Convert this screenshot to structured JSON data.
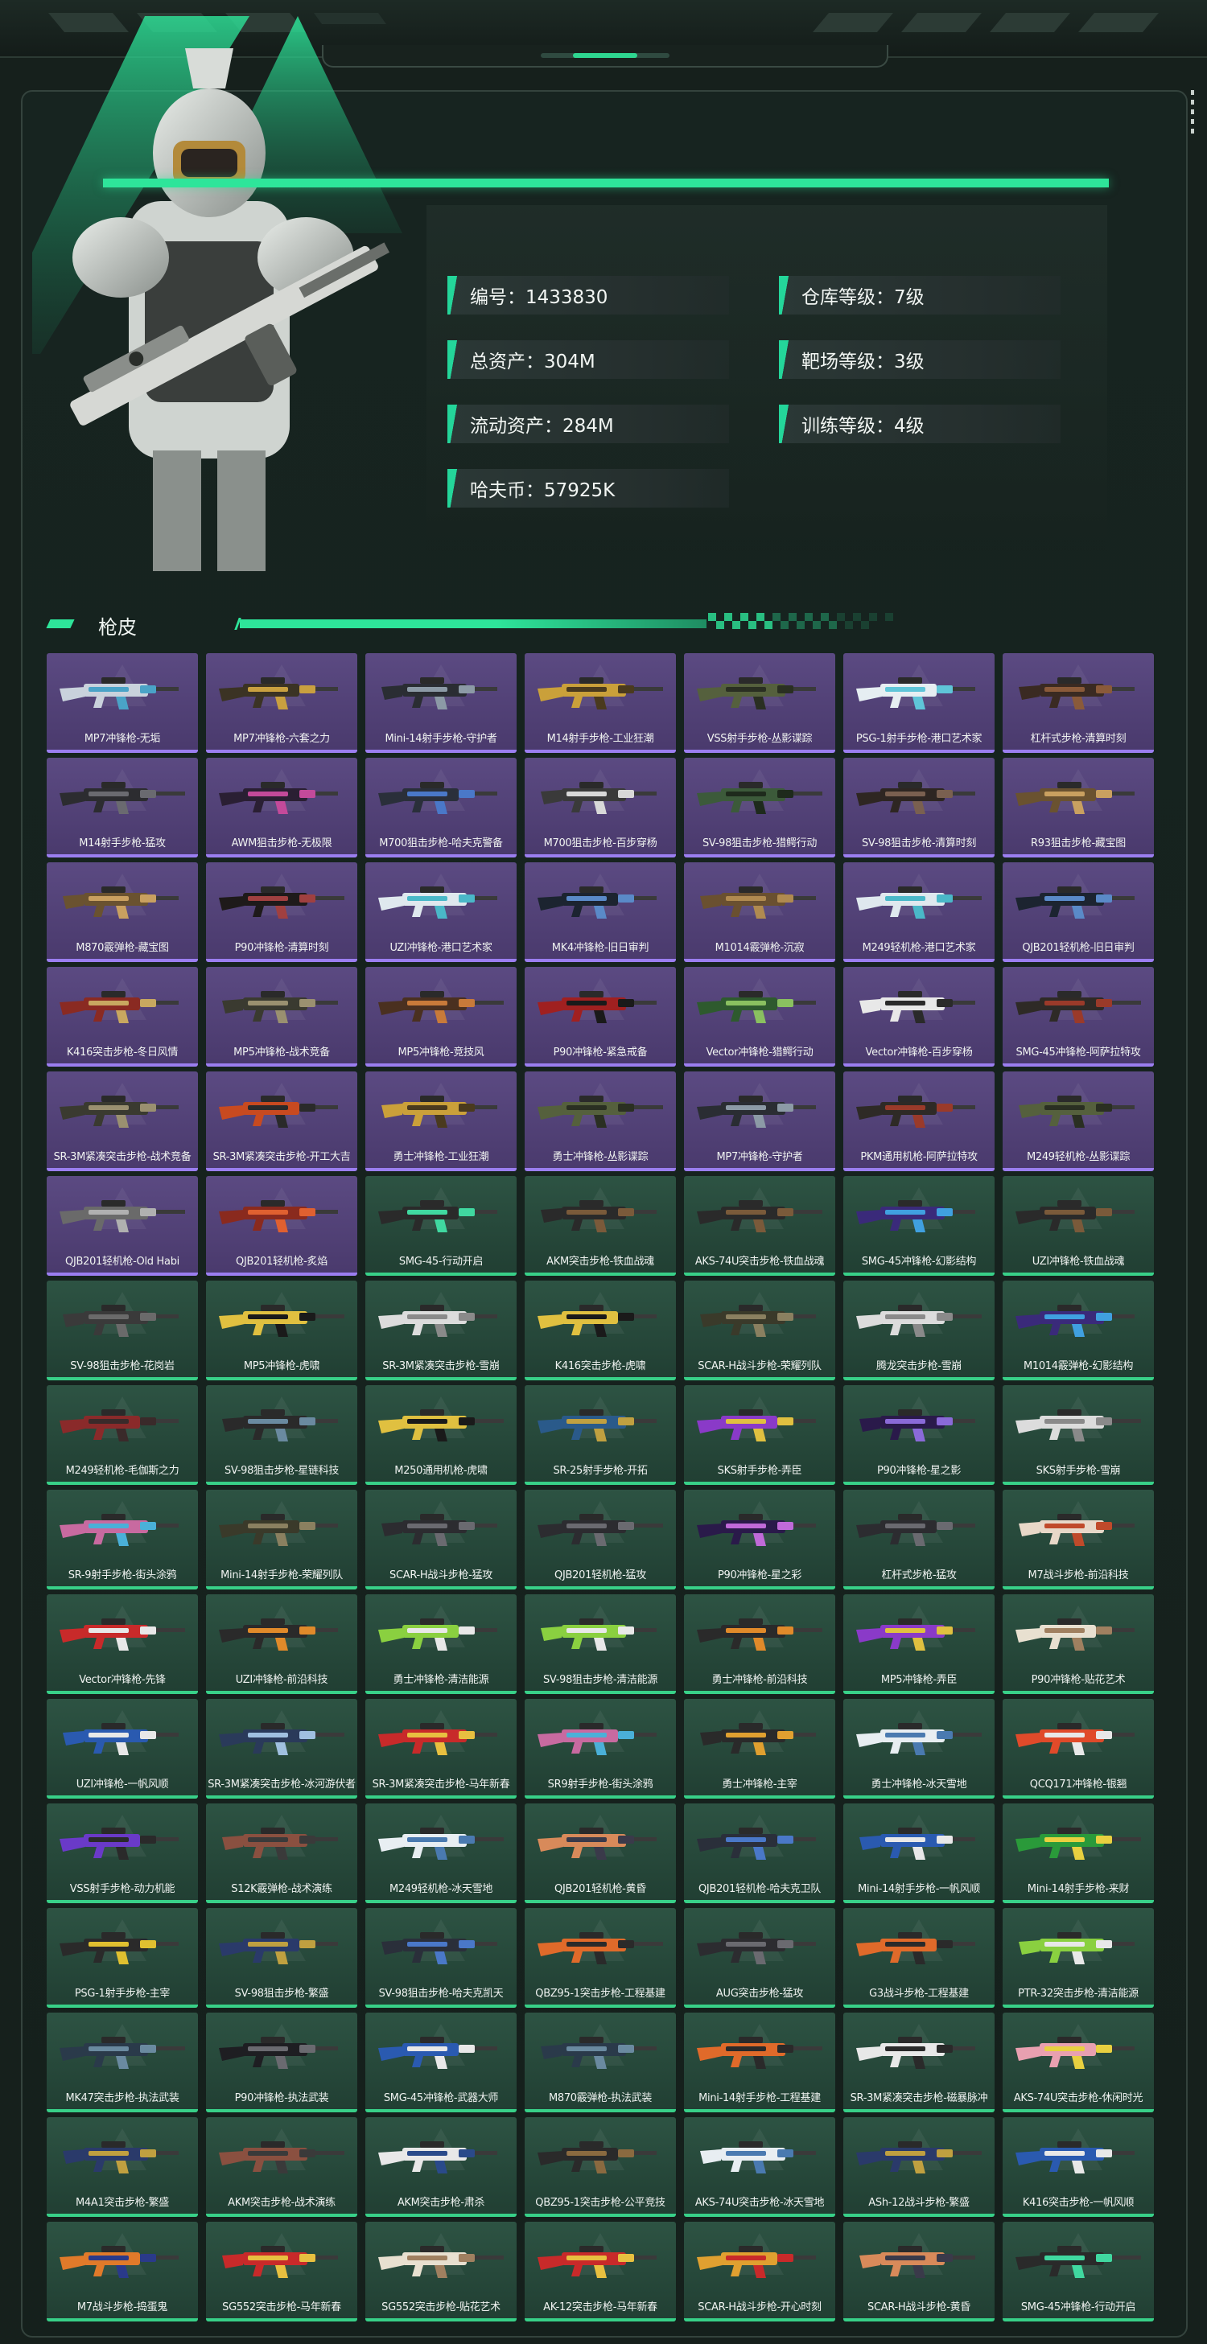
{
  "profile": {
    "stats": [
      {
        "label": "编号：1433830"
      },
      {
        "label": "仓库等级：7级"
      },
      {
        "label": "总资产：304M"
      },
      {
        "label": "靶场等级：3级"
      },
      {
        "label": "流动资产：284M"
      },
      {
        "label": "训练等级：4级"
      },
      {
        "label": "哈夫币：57925K"
      }
    ]
  },
  "section": {
    "title": "枪皮"
  },
  "colors": {
    "accent": "#2ee59a",
    "purple_card": "#4f3f74",
    "green_card": "#264a3b"
  },
  "skins": [
    {
      "name": "MP7冲锋枪-无垢",
      "rarity": "purple",
      "c1": "#c9d2dc",
      "c2": "#4aa3c7"
    },
    {
      "name": "MP7冲锋枪-六套之力",
      "rarity": "purple",
      "c1": "#3b3324",
      "c2": "#c9a040"
    },
    {
      "name": "Mini-14射手步枪-守护者",
      "rarity": "purple",
      "c1": "#2a2d33",
      "c2": "#8c9aa6"
    },
    {
      "name": "M14射手步枪-工业狂潮",
      "rarity": "purple",
      "c1": "#caa03a",
      "c2": "#4a3a1e"
    },
    {
      "name": "VSS射手步枪-丛影谍踪",
      "rarity": "purple",
      "c1": "#55603d",
      "c2": "#2a2f22"
    },
    {
      "name": "PSG-1射手步枪-港口艺术家",
      "rarity": "purple",
      "c1": "#e6eef2",
      "c2": "#5fc5d8"
    },
    {
      "name": "杠杆式步枪-清算时刻",
      "rarity": "purple",
      "c1": "#3a2a22",
      "c2": "#8a5a3a"
    },
    {
      "name": "M14射手步枪-猛攻",
      "rarity": "purple",
      "c1": "#2c2c30",
      "c2": "#6a6a70"
    },
    {
      "name": "AWM狙击步枪-无极限",
      "rarity": "purple",
      "c1": "#2a1f33",
      "c2": "#c34a9a"
    },
    {
      "name": "M700狙击步枪-哈夫克警备",
      "rarity": "purple",
      "c1": "#2a2f3a",
      "c2": "#4a78c8"
    },
    {
      "name": "M700狙击步枪-百步穿杨",
      "rarity": "purple",
      "c1": "#3a3a3a",
      "c2": "#d8d8d8"
    },
    {
      "name": "SV-98狙击步枪-猎鳄行动",
      "rarity": "purple",
      "c1": "#3c5a3a",
      "c2": "#1e2a1c"
    },
    {
      "name": "SV-98狙击步枪-清算时刻",
      "rarity": "purple",
      "c1": "#2e2622",
      "c2": "#7a6050"
    },
    {
      "name": "R93狙击步枪-藏宝图",
      "rarity": "purple",
      "c1": "#6a5230",
      "c2": "#c9a060"
    },
    {
      "name": "M870霰弹枪-藏宝图",
      "rarity": "purple",
      "c1": "#6a5230",
      "c2": "#c9a060"
    },
    {
      "name": "P90冲锋枪-清算时刻",
      "rarity": "purple",
      "c1": "#1e1a1a",
      "c2": "#a04040"
    },
    {
      "name": "UZI冲锋枪-港口艺术家",
      "rarity": "purple",
      "c1": "#dfe8ee",
      "c2": "#4ab8c8"
    },
    {
      "name": "MK4冲锋枪-旧日审判",
      "rarity": "purple",
      "c1": "#1c2430",
      "c2": "#5a8ac8"
    },
    {
      "name": "M1014霰弹枪-沉寂",
      "rarity": "purple",
      "c1": "#6a5030",
      "c2": "#b08a50"
    },
    {
      "name": "M249轻机枪-港口艺术家",
      "rarity": "purple",
      "c1": "#dfe8ee",
      "c2": "#4ab8c8"
    },
    {
      "name": "QJB201轻机枪-旧日审判",
      "rarity": "purple",
      "c1": "#1c2430",
      "c2": "#5a8ac8"
    },
    {
      "name": "K416突击步枪-冬日风情",
      "rarity": "purple",
      "c1": "#8a2a22",
      "c2": "#c8a860"
    },
    {
      "name": "MP5冲锋枪-战术竞备",
      "rarity": "purple",
      "c1": "#3a3a30",
      "c2": "#9a9070"
    },
    {
      "name": "MP5冲锋枪-竞技风",
      "rarity": "purple",
      "c1": "#4a3020",
      "c2": "#c87a3a"
    },
    {
      "name": "P90冲锋枪-紧急戒备",
      "rarity": "purple",
      "c1": "#a02020",
      "c2": "#1a1a1a"
    },
    {
      "name": "Vector冲锋枪-猎鳄行动",
      "rarity": "purple",
      "c1": "#2e5a2e",
      "c2": "#8ac060"
    },
    {
      "name": "Vector冲锋枪-百步穿杨",
      "rarity": "purple",
      "c1": "#e8e8e8",
      "c2": "#2a2a2a"
    },
    {
      "name": "SMG-45冲锋枪-阿萨拉特攻",
      "rarity": "purple",
      "c1": "#2e2a26",
      "c2": "#9a3a2a"
    },
    {
      "name": "SR-3M紧凑突击步枪-战术竞备",
      "rarity": "purple",
      "c1": "#3a3a30",
      "c2": "#9a9070"
    },
    {
      "name": "SR-3M紧凑突击步枪-开工大吉",
      "rarity": "purple",
      "c1": "#c84a20",
      "c2": "#2a2a2a"
    },
    {
      "name": "勇士冲锋枪-工业狂潮",
      "rarity": "purple",
      "c1": "#caa03a",
      "c2": "#4a3a1e"
    },
    {
      "name": "勇士冲锋枪-丛影谍踪",
      "rarity": "purple",
      "c1": "#55603d",
      "c2": "#2a2f22"
    },
    {
      "name": "MP7冲锋枪-守护者",
      "rarity": "purple",
      "c1": "#2a2d33",
      "c2": "#8c9aa6"
    },
    {
      "name": "PKM通用机枪-阿萨拉特攻",
      "rarity": "purple",
      "c1": "#2e2a26",
      "c2": "#9a3a2a"
    },
    {
      "name": "M249轻机枪-丛影谍踪",
      "rarity": "purple",
      "c1": "#55603d",
      "c2": "#2a2f22"
    },
    {
      "name": "QJB201轻机枪-Old Habi",
      "rarity": "purple",
      "c1": "#6a6a6a",
      "c2": "#b0b0b0"
    },
    {
      "name": "QJB201轻机枪-炙焰",
      "rarity": "purple",
      "c1": "#8a2a1e",
      "c2": "#e06030"
    },
    {
      "name": "SMG-45-行动开启",
      "rarity": "green",
      "c1": "#2a2a2a",
      "c2": "#40d8a0"
    },
    {
      "name": "AKM突击步枪-铁血战魂",
      "rarity": "green",
      "c1": "#2a2a2a",
      "c2": "#7a5a3a"
    },
    {
      "name": "AKS-74U突击步枪-铁血战魂",
      "rarity": "green",
      "c1": "#2a2a2a",
      "c2": "#7a5a3a"
    },
    {
      "name": "SMG-45冲锋枪-幻影结构",
      "rarity": "green",
      "c1": "#3a2a7a",
      "c2": "#40a0e0"
    },
    {
      "name": "UZI冲锋枪-铁血战魂",
      "rarity": "green",
      "c1": "#2a2a2a",
      "c2": "#7a5a3a"
    },
    {
      "name": "SV-98狙击步枪-花岗岩",
      "rarity": "green",
      "c1": "#3a3a3a",
      "c2": "#6a6a6a"
    },
    {
      "name": "MP5冲锋枪-虎啸",
      "rarity": "green",
      "c1": "#e0c040",
      "c2": "#1a1a1a"
    },
    {
      "name": "SR-3M紧凑突击步枪-雪崩",
      "rarity": "green",
      "c1": "#dcdcdc",
      "c2": "#8a8a8a"
    },
    {
      "name": "K416突击步枪-虎啸",
      "rarity": "green",
      "c1": "#e0c040",
      "c2": "#1a1a1a"
    },
    {
      "name": "SCAR-H战斗步枪-荣耀列队",
      "rarity": "green",
      "c1": "#3a3a2a",
      "c2": "#8a8060"
    },
    {
      "name": "腾龙突击步枪-雪崩",
      "rarity": "green",
      "c1": "#dcdcdc",
      "c2": "#8a8a8a"
    },
    {
      "name": "M1014霰弹枪-幻影结构",
      "rarity": "green",
      "c1": "#3a2a7a",
      "c2": "#40a0e0"
    },
    {
      "name": "M249轻机枪-毛伽斯之力",
      "rarity": "green",
      "c1": "#8a2a2a",
      "c2": "#3a2a2a"
    },
    {
      "name": "SV-98狙击步枪-星链科技",
      "rarity": "green",
      "c1": "#2a2a2a",
      "c2": "#6a8aa0"
    },
    {
      "name": "M250通用机枪-虎啸",
      "rarity": "green",
      "c1": "#e0c040",
      "c2": "#1a1a1a"
    },
    {
      "name": "SR-25射手步枪-开拓",
      "rarity": "green",
      "c1": "#2a5a8a",
      "c2": "#c0a040"
    },
    {
      "name": "SKS射手步枪-弄臣",
      "rarity": "green",
      "c1": "#8a3ac8",
      "c2": "#e0c040"
    },
    {
      "name": "P90冲锋枪-星之影",
      "rarity": "green",
      "c1": "#2a1a4a",
      "c2": "#8a6ad8"
    },
    {
      "name": "SKS射手步枪-雪崩",
      "rarity": "green",
      "c1": "#dcdcdc",
      "c2": "#8a8a8a"
    },
    {
      "name": "SR-9射手步枪-街头涂鸦",
      "rarity": "green",
      "c1": "#c86aa0",
      "c2": "#4ab0d8"
    },
    {
      "name": "Mini-14射手步枪-荣耀列队",
      "rarity": "green",
      "c1": "#3a3a2a",
      "c2": "#8a8060"
    },
    {
      "name": "SCAR-H战斗步枪-猛攻",
      "rarity": "green",
      "c1": "#2c2c30",
      "c2": "#6a6a70"
    },
    {
      "name": "QJB201轻机枪-猛攻",
      "rarity": "green",
      "c1": "#2c2c30",
      "c2": "#6a6a70"
    },
    {
      "name": "P90冲锋枪-星之彩",
      "rarity": "green",
      "c1": "#2a1a4a",
      "c2": "#c06ad8"
    },
    {
      "name": "杠杆式步枪-猛攻",
      "rarity": "green",
      "c1": "#2c2c30",
      "c2": "#6a6a70"
    },
    {
      "name": "M7战斗步枪-前沿科技",
      "rarity": "green",
      "c1": "#e8d8c8",
      "c2": "#c04a2a"
    },
    {
      "name": "Vector冲锋枪-先锋",
      "rarity": "green",
      "c1": "#c82a2a",
      "c2": "#e8e8e8"
    },
    {
      "name": "UZI冲锋枪-前沿科技",
      "rarity": "green",
      "c1": "#2a2a2a",
      "c2": "#e08a2a"
    },
    {
      "name": "勇士冲锋枪-清洁能源",
      "rarity": "green",
      "c1": "#8ad040",
      "c2": "#e8e8e8"
    },
    {
      "name": "SV-98狙击步枪-清洁能源",
      "rarity": "green",
      "c1": "#8ad040",
      "c2": "#e8e8e8"
    },
    {
      "name": "勇士冲锋枪-前沿科技",
      "rarity": "green",
      "c1": "#2a2a2a",
      "c2": "#e08a2a"
    },
    {
      "name": "MP5冲锋枪-弄臣",
      "rarity": "green",
      "c1": "#8a3ac8",
      "c2": "#e0c040"
    },
    {
      "name": "P90冲锋枪-贴花艺术",
      "rarity": "green",
      "c1": "#e8e0d0",
      "c2": "#a08060"
    },
    {
      "name": "UZI冲锋枪-一帆风顺",
      "rarity": "green",
      "c1": "#2a5ab0",
      "c2": "#e8e8e8"
    },
    {
      "name": "SR-3M紧凑突击步枪-冰河游伏者",
      "rarity": "green",
      "c1": "#2a3a5a",
      "c2": "#a0c0e0"
    },
    {
      "name": "SR-3M紧凑突击步枪-马年新春",
      "rarity": "green",
      "c1": "#c82a2a",
      "c2": "#e8c040"
    },
    {
      "name": "SR9射手步枪-街头涂鸦",
      "rarity": "green",
      "c1": "#c86aa0",
      "c2": "#4ab0d8"
    },
    {
      "name": "勇士冲锋枪-主宰",
      "rarity": "green",
      "c1": "#2a2a2a",
      "c2": "#e0a030"
    },
    {
      "name": "勇士冲锋枪-冰天雪地",
      "rarity": "green",
      "c1": "#e8eef2",
      "c2": "#4a7ab0"
    },
    {
      "name": "QCQ171冲锋枪-银翘",
      "rarity": "green",
      "c1": "#e04a2a",
      "c2": "#e8e8e8"
    },
    {
      "name": "VSS射手步枪-动力机能",
      "rarity": "green",
      "c1": "#6a3ac8",
      "c2": "#2a2a2a"
    },
    {
      "name": "S12K霰弹枪-战术演练",
      "rarity": "green",
      "c1": "#8a5040",
      "c2": "#3a3a3a"
    },
    {
      "name": "M249轻机枪-冰天雪地",
      "rarity": "green",
      "c1": "#e8eef2",
      "c2": "#4a7ab0"
    },
    {
      "name": "QJB201轻机枪-黄昏",
      "rarity": "green",
      "c1": "#d88a5a",
      "c2": "#3a3a4a"
    },
    {
      "name": "QJB201轻机枪-哈夫克卫队",
      "rarity": "green",
      "c1": "#2a2f3a",
      "c2": "#4a78c8"
    },
    {
      "name": "Mini-14射手步枪-一帆风顺",
      "rarity": "green",
      "c1": "#2a5ab0",
      "c2": "#e8e8e8"
    },
    {
      "name": "Mini-14射手步枪-来财",
      "rarity": "green",
      "c1": "#2a9a3a",
      "c2": "#e8d040"
    },
    {
      "name": "PSG-1射手步枪-主宰",
      "rarity": "green",
      "c1": "#2a2a2a",
      "c2": "#e0c030"
    },
    {
      "name": "SV-98狙击步枪-繁盛",
      "rarity": "green",
      "c1": "#2a3a6a",
      "c2": "#c0a040"
    },
    {
      "name": "SV-98狙击步枪-哈夫克凯天",
      "rarity": "green",
      "c1": "#2a2f3a",
      "c2": "#4a78c8"
    },
    {
      "name": "QBZ95-1突击步枪-工程基建",
      "rarity": "green",
      "c1": "#e06a2a",
      "c2": "#2a2a2a"
    },
    {
      "name": "AUG突击步枪-猛攻",
      "rarity": "green",
      "c1": "#2c2c30",
      "c2": "#6a6a70"
    },
    {
      "name": "G3战斗步枪-工程基建",
      "rarity": "green",
      "c1": "#e06a2a",
      "c2": "#2a2a2a"
    },
    {
      "name": "PTR-32突击步枪-清洁能源",
      "rarity": "green",
      "c1": "#8ad040",
      "c2": "#e8e8e8"
    },
    {
      "name": "MK47突击步枪-执法武装",
      "rarity": "green",
      "c1": "#2a3a4a",
      "c2": "#6a8aa0"
    },
    {
      "name": "P90冲锋枪-执法武装",
      "rarity": "green",
      "c1": "#1e1e22",
      "c2": "#6a6a70"
    },
    {
      "name": "SMG-45冲锋枪-武器大师",
      "rarity": "green",
      "c1": "#2a5ab0",
      "c2": "#e8e8e8"
    },
    {
      "name": "M870霰弹枪-执法武装",
      "rarity": "green",
      "c1": "#2a3a4a",
      "c2": "#6a8aa0"
    },
    {
      "name": "Mini-14射手步枪-工程基建",
      "rarity": "green",
      "c1": "#e06a2a",
      "c2": "#2a2a2a"
    },
    {
      "name": "SR-3M紧凑突击步枪-磁暴脉冲",
      "rarity": "green",
      "c1": "#e8e8e8",
      "c2": "#2a2a2a"
    },
    {
      "name": "AKS-74U突击步枪-休闲时光",
      "rarity": "green",
      "c1": "#e8a0b0",
      "c2": "#e8d040"
    },
    {
      "name": "M4A1突击步枪-繁盛",
      "rarity": "green",
      "c1": "#2a3a6a",
      "c2": "#c0a040"
    },
    {
      "name": "AKM突击步枪-战术演练",
      "rarity": "green",
      "c1": "#8a5040",
      "c2": "#3a3a3a"
    },
    {
      "name": "AKM突击步枪-肃杀",
      "rarity": "green",
      "c1": "#e8e8e8",
      "c2": "#2a4a8a"
    },
    {
      "name": "QBZ95-1突击步枪-公平竞技",
      "rarity": "green",
      "c1": "#2a2a2a",
      "c2": "#8a6a40"
    },
    {
      "name": "AKS-74U突击步枪-冰天雪地",
      "rarity": "green",
      "c1": "#e8eef2",
      "c2": "#4a7ab0"
    },
    {
      "name": "ASh-12战斗步枪-繁盛",
      "rarity": "green",
      "c1": "#2a3a6a",
      "c2": "#c0a040"
    },
    {
      "name": "K416突击步枪-一帆风顺",
      "rarity": "green",
      "c1": "#2a5ab0",
      "c2": "#e8e8e8"
    },
    {
      "name": "M7战斗步枪-捣蛋鬼",
      "rarity": "green",
      "c1": "#e07a2a",
      "c2": "#2a3a8a"
    },
    {
      "name": "SG552突击步枪-马年新春",
      "rarity": "green",
      "c1": "#c82a2a",
      "c2": "#e8c040"
    },
    {
      "name": "SG552突击步枪-贴花艺术",
      "rarity": "green",
      "c1": "#e8e0d0",
      "c2": "#a08060"
    },
    {
      "name": "AK-12突击步枪-马年新春",
      "rarity": "green",
      "c1": "#c82a2a",
      "c2": "#e8c040"
    },
    {
      "name": "SCAR-H战斗步枪-开心时刻",
      "rarity": "green",
      "c1": "#e0a030",
      "c2": "#c82a2a"
    },
    {
      "name": "SCAR-H战斗步枪-黄昏",
      "rarity": "green",
      "c1": "#d88a5a",
      "c2": "#3a3a4a"
    },
    {
      "name": "SMG-45冲锋枪-行动开启",
      "rarity": "green",
      "c1": "#2a2a2a",
      "c2": "#40d8a0"
    }
  ]
}
